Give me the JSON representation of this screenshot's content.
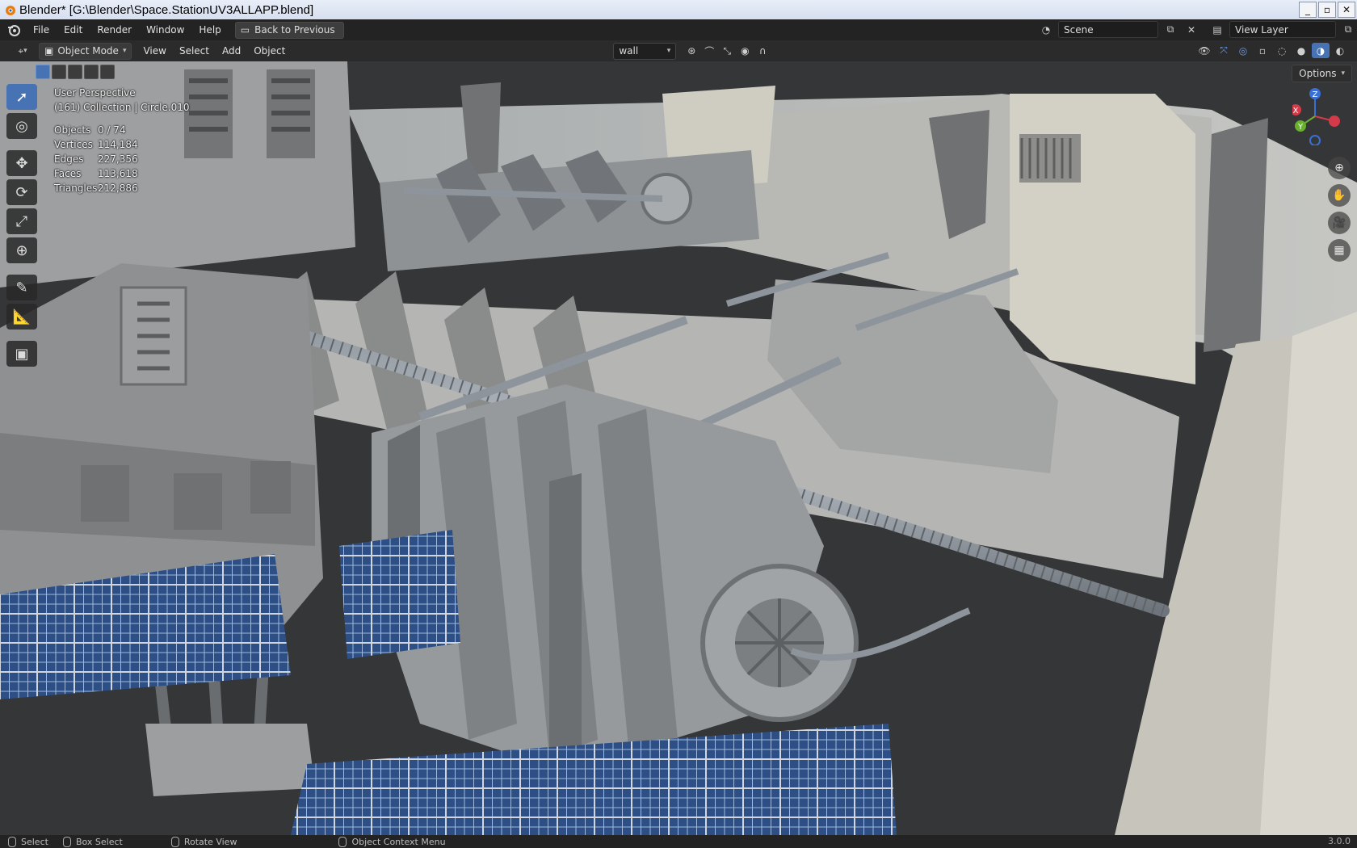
{
  "window": {
    "title": "Blender* [G:\\Blender\\Space.StationUV3ALLAPP.blend]",
    "minimize": "_",
    "maximize": "▫",
    "close": "✕"
  },
  "menubar": {
    "items": [
      "File",
      "Edit",
      "Render",
      "Window",
      "Help"
    ],
    "back_button": "Back to Previous",
    "scene": "Scene",
    "view_layer": "View Layer"
  },
  "viewport_header": {
    "mode": "Object Mode",
    "menus": [
      "View",
      "Select",
      "Add",
      "Object"
    ],
    "transform_orientation": "wall",
    "options": "Options"
  },
  "overlay": {
    "perspective": "User Perspective",
    "collection": "(161) Collection | Circle.010",
    "stats": [
      {
        "label": "Objects",
        "value": "0 / 74"
      },
      {
        "label": "Vertices",
        "value": "114,184"
      },
      {
        "label": "Edges",
        "value": "227,356"
      },
      {
        "label": "Faces",
        "value": "113,618"
      },
      {
        "label": "Triangles",
        "value": "212,886"
      }
    ]
  },
  "gizmo": {
    "z": "Z",
    "x": "X",
    "y": "Y"
  },
  "tools": [
    "select-box-icon",
    "cursor-icon",
    "move-icon",
    "rotate-icon",
    "scale-icon",
    "transform-icon",
    "annotate-icon",
    "measure-icon",
    "add-cube-icon"
  ],
  "statusbar": {
    "select": "Select",
    "box_select": "Box Select",
    "rotate_view": "Rotate View",
    "context_menu": "Object Context Menu",
    "version": "3.0.0"
  },
  "colors": {
    "accent": "#4772b3",
    "titlebar": "#dbe4f2",
    "header": "#2b2b2b"
  }
}
